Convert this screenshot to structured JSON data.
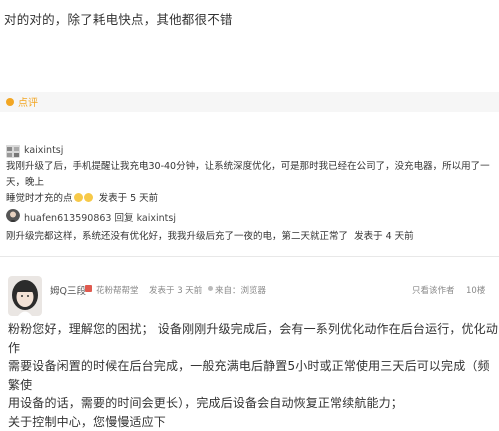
{
  "top_comment": "对的对的，除了耗电快点，其他都很不错",
  "comment_section": {
    "label": "点评"
  },
  "replies": [
    {
      "username": "kaixintsj",
      "reply_to": "",
      "reply_label": "",
      "text_line1": "我刚升级了后，手机提醒让我充电30-40分钟，让系统深度优化，可是那时我已经在公司了，没充电器，所以用了一天，晚上",
      "text_line2": "睡觉时才充的点",
      "time": "发表于 5 天前"
    },
    {
      "username": "huafen613590863",
      "reply_label": "回复",
      "reply_to": "kaixintsj",
      "text_line1": "刚升级完都这样，系统还没有优化好，我我升级后充了一夜的电，第二天就正常了",
      "text_line2": "",
      "time": "发表于 4 天前"
    }
  ],
  "answer": {
    "username": "姆Q三段",
    "badge": "花粉帮帮堂",
    "posted": "发表于 3 天前",
    "source": "来自：浏览器",
    "only_author": "只看该作者",
    "floor": "10楼",
    "lines": [
      "粉粉您好，理解您的困扰； 设备刚刚升级完成后，会有一系列优化动作在后台运行，优化动作",
      "需要设备闲置的时候在后台完成，一般充满电后静置5小时或正常使用三天后可以完成（频繁使",
      "用设备的话，需要的时间会更长），完成后设备会自动恢复正常续航能力；",
      "关于控制中心，您慢慢适应下"
    ]
  },
  "colors": {
    "accent": "#f2a623",
    "badge": "#e05a4f"
  }
}
